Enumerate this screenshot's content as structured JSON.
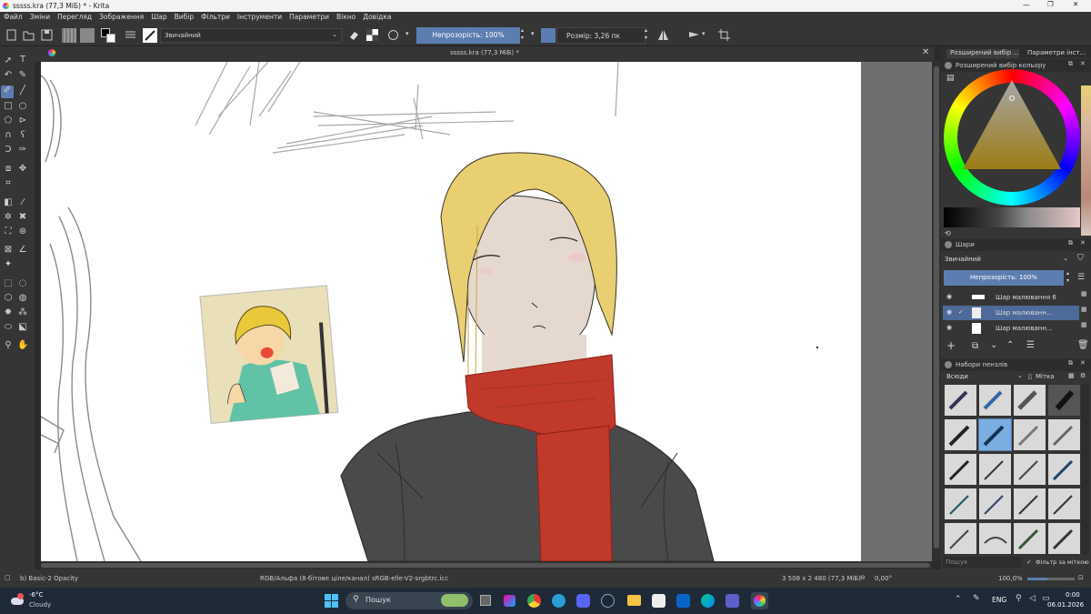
{
  "window": {
    "title": "sssss.kra (77,3 МіБ) * - Krita"
  },
  "menu": [
    "Файл",
    "Зміни",
    "Перегляд",
    "Зображення",
    "Шар",
    "Вибір",
    "Фільтри",
    "Інструменти",
    "Параметри",
    "Вікно",
    "Довідка"
  ],
  "toolbar": {
    "blend_mode": "Звичайний",
    "opacity_label": "Непрозорість: 100%",
    "size_label": "Розмір: 3,26 пк"
  },
  "document": {
    "tab_title": "sssss.kra (77,3 МіБ) *"
  },
  "dock": {
    "tabs": [
      "Розширений вибір ...",
      "Параметри інст..."
    ],
    "color_panel_title": "Розширений вибір кольору",
    "layers_title": "Шари",
    "layer_blend_mode": "Звичайний",
    "layer_opacity_label": "Непрозорість: 100%",
    "layers": [
      "Шар малювання 6",
      "Шар малюванн...",
      "Шар малюванн..."
    ],
    "brushes_title": "Набори пензлів",
    "brush_filter": "Всюди",
    "brush_tag_label": "Мітка",
    "brush_search_placeholder": "Пошук",
    "filter_by_tag": "Фільтр за міткою"
  },
  "status": {
    "brush_preset": "b) Basic-2 Opacity",
    "color_space": "RGB/Альфа (8-бітове ціле/канал)  sRGB-elle-V2-srgbtrc.icc",
    "dimensions": "3 508 x 2 480 (77,3 МіБ)",
    "rotation": "0,00°",
    "zoom": "100,0%"
  },
  "taskbar": {
    "temperature": "-6°C",
    "weather": "Cloudy",
    "search_placeholder": "Пошук",
    "language": "ENG",
    "time": "0:00",
    "date": "06.01.2026"
  },
  "colors": {
    "accent": "#5b7db0",
    "scarf": "#c0392b",
    "hair": "#e8cf72",
    "coat": "#4a4a4a"
  }
}
